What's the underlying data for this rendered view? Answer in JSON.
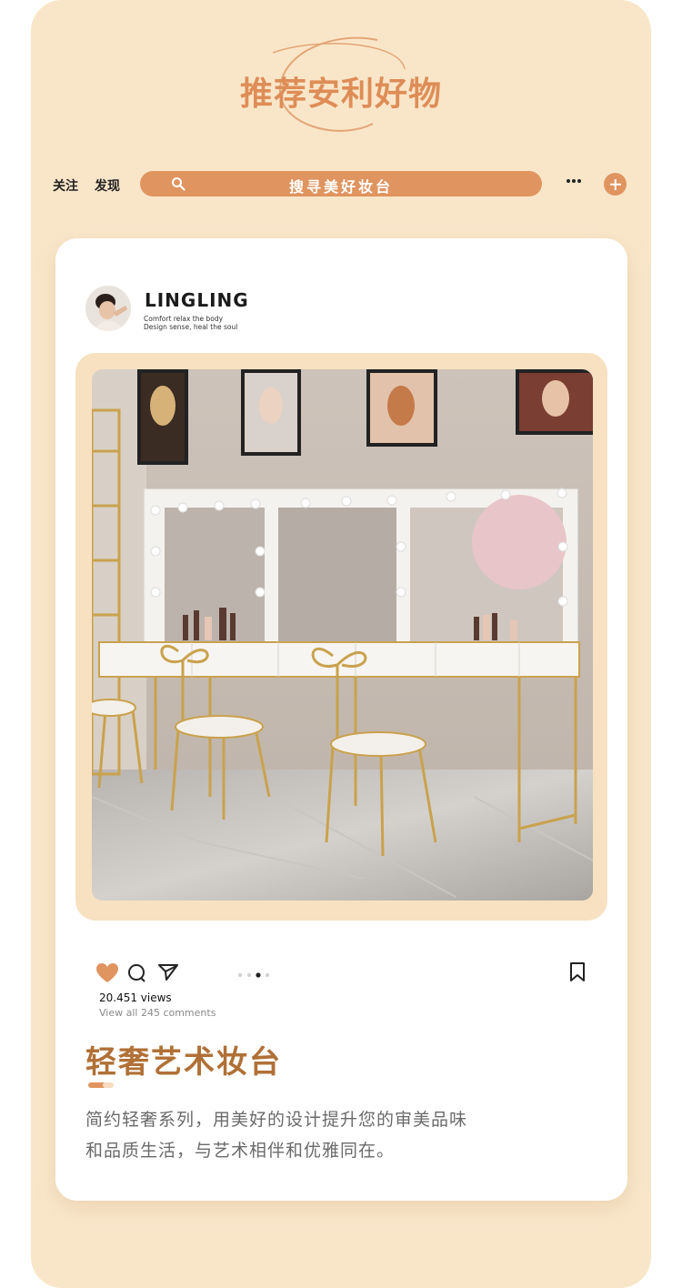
{
  "header": {
    "title": "推荐安利好物"
  },
  "nav": {
    "tabs": [
      "关注",
      "发现"
    ],
    "search_text": "搜寻美好妆台"
  },
  "post": {
    "username": "LINGLING",
    "tagline_line1": "Comfort relax the body",
    "tagline_line2": "Design sense, heal the soul",
    "views": "20.451 views",
    "comments": "View all 245 comments",
    "carousel_active_index": 2,
    "carousel_count": 4
  },
  "product": {
    "title": "轻奢艺术妆台",
    "description_line1": "简约轻奢系列，用美好的设计提升您的审美品味",
    "description_line2": "和品质生活，与艺术相伴和优雅同在。"
  },
  "colors": {
    "background": "#f9e6c9",
    "accent": "#e0945f",
    "title": "#de8d57",
    "product_title": "#b07036"
  },
  "icons": [
    "search-icon",
    "more-icon",
    "plus-icon",
    "heart-icon",
    "comment-icon",
    "share-icon",
    "bookmark-icon"
  ]
}
